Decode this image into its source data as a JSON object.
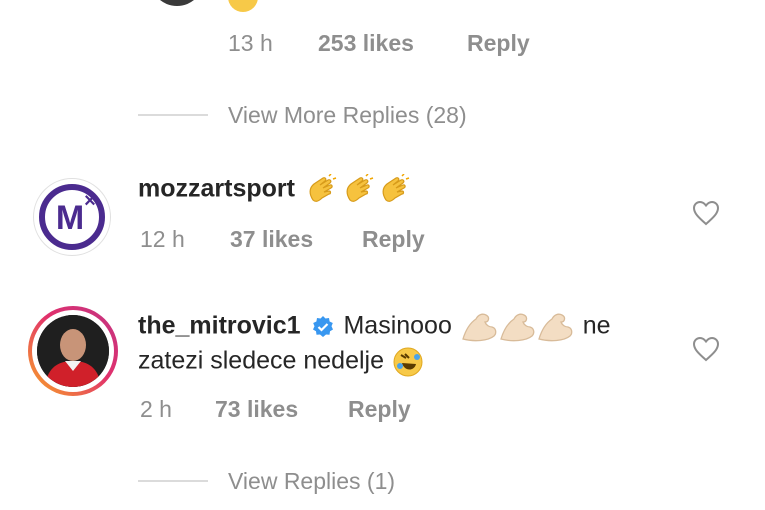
{
  "top_comment": {
    "time": "13 h",
    "likes": "253 likes",
    "reply": "Reply"
  },
  "view_more_replies": "View More Replies (28)",
  "comment1": {
    "username": "mozzartsport",
    "avatar_letter": "M",
    "avatar_mark": "×",
    "time": "12 h",
    "likes": "37 likes",
    "reply": "Reply",
    "emojis": [
      "clapping-hands",
      "clapping-hands",
      "clapping-hands"
    ]
  },
  "comment2": {
    "username": "the_mitrovic1",
    "verified": true,
    "text_line1": "Masinooo",
    "text_line1b": "ne",
    "text_line2": "zatezi sledece nedelje",
    "time": "2 h",
    "likes": "73 likes",
    "reply": "Reply",
    "emojis": [
      "flexed-biceps",
      "flexed-biceps",
      "flexed-biceps",
      "rolling-laughing"
    ]
  },
  "view_replies": "View Replies (1)",
  "colors": {
    "mozzart_purple": "#4b2b8f",
    "mozzart_orange": "#f39200",
    "verified_blue": "#3897f0",
    "meta_gray": "#8e8e8e"
  }
}
